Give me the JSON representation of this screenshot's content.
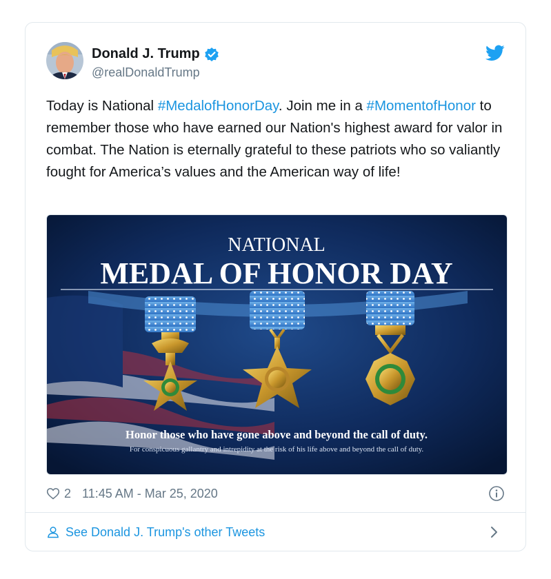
{
  "author": {
    "name": "Donald J. Trump",
    "handle": "@realDonaldTrump"
  },
  "tweet": {
    "text_1": "Today is National ",
    "hashtag_1": "#MedalofHonorDay",
    "text_2": ". Join me in a ",
    "hashtag_2": "#MomentofHonor",
    "text_3": " to remember those who have earned our Nation's highest award for valor in combat. The Nation is eternally grateful to these patriots who so valiantly fought for America’s values and the American way of life!"
  },
  "media": {
    "line1": "NATIONAL",
    "line2": "MEDAL OF HONOR DAY",
    "tagline": "Honor those who have gone above and beyond the call of duty.",
    "subtagline": "For conspicuous gallantry and intrepidity at the risk of his life above and beyond the call of duty."
  },
  "meta": {
    "like_count": "2",
    "timestamp": "11:45 AM - Mar 25, 2020"
  },
  "footer": {
    "link_label": "See Donald J. Trump's other Tweets"
  },
  "colors": {
    "link_blue": "#1b95e0",
    "twitter_blue": "#1da1f2",
    "muted_gray": "#657786",
    "border": "#e1e8ed"
  },
  "icons": [
    "avatar",
    "verified-badge-icon",
    "twitter-bird-icon",
    "heart-icon",
    "info-icon",
    "person-icon",
    "chevron-right-icon"
  ]
}
